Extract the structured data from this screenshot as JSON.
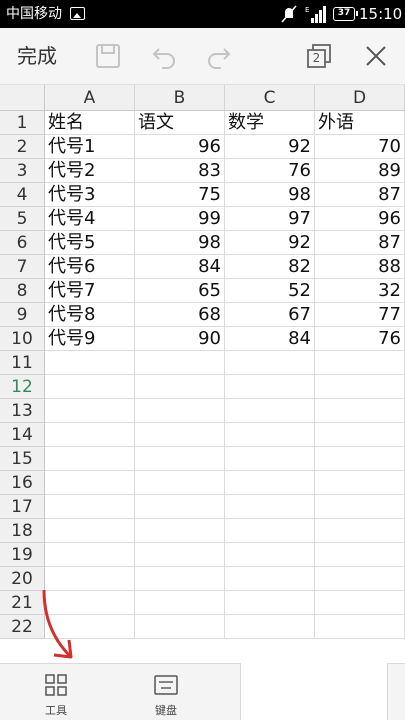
{
  "status_bar": {
    "carrier": "中国移动",
    "battery": "37",
    "time": "15:10"
  },
  "toolbar": {
    "done_label": "完成",
    "icons": [
      "save-icon",
      "undo-icon",
      "redo-icon",
      "window-switch-icon",
      "close-icon"
    ],
    "window_count": "2"
  },
  "sheet": {
    "columns": [
      "A",
      "B",
      "C",
      "D"
    ],
    "rows": [
      "1",
      "2",
      "3",
      "4",
      "5",
      "6",
      "7",
      "8",
      "9",
      "10",
      "11",
      "12",
      "13",
      "14",
      "15",
      "16",
      "17",
      "18",
      "19",
      "20",
      "21",
      "22"
    ],
    "active_row": "12",
    "cells": [
      [
        "姓名",
        "语文",
        "数学",
        "外语"
      ],
      [
        "代号1",
        "96",
        "92",
        "70"
      ],
      [
        "代号2",
        "83",
        "76",
        "89"
      ],
      [
        "代号3",
        "75",
        "98",
        "87"
      ],
      [
        "代号4",
        "99",
        "97",
        "96"
      ],
      [
        "代号5",
        "98",
        "92",
        "87"
      ],
      [
        "代号6",
        "84",
        "82",
        "88"
      ],
      [
        "代号7",
        "65",
        "52",
        "32"
      ],
      [
        "代号8",
        "68",
        "67",
        "77"
      ],
      [
        "代号9",
        "90",
        "84",
        "76"
      ]
    ]
  },
  "bottom_bar": {
    "tools_label": "工具",
    "keyboard_label": "键盘"
  },
  "colors": {
    "active_row": "#2e8b57",
    "arrow": "#d32f2f"
  }
}
